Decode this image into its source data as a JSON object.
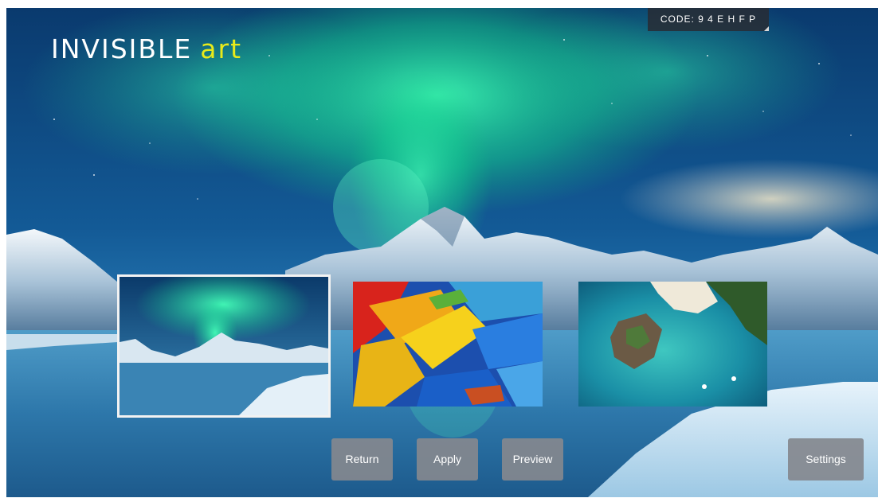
{
  "logo": {
    "word1": "INVISIBLE",
    "word2": "art",
    "word1_color": "#ffffff",
    "word2_color": "#e8ea1a"
  },
  "code": {
    "text": "CODE: 9 4 E H F P"
  },
  "thumbnails": [
    {
      "subject": "aurora over snowy mountains and lake",
      "selected": true
    },
    {
      "subject": "colorful parrot feathers",
      "selected": false
    },
    {
      "subject": "aerial view of island in turquoise sea",
      "selected": false
    }
  ],
  "buttons": {
    "return": "Return",
    "apply": "Apply",
    "preview": "Preview",
    "settings": "Settings"
  },
  "colors": {
    "button_bg": "#84888e",
    "badge_bg": "#282c34",
    "selection_border": "#f2f2f2"
  }
}
